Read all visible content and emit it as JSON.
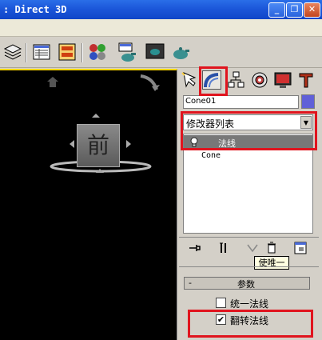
{
  "window": {
    "title": ": Direct 3D",
    "buttons": [
      "_",
      "❐",
      "✕"
    ]
  },
  "viewport": {
    "viewcube_label": "前"
  },
  "command_panel": {
    "object_name": "Cone01",
    "color_swatch": "#6060d8",
    "modifier_list_label": "修改器列表",
    "stack": {
      "selected_modifier": "法线",
      "base_object": "Cone"
    },
    "tooltip": "使唯一",
    "rollout": {
      "collapse_symbol": "-",
      "title": "参数",
      "options": [
        {
          "label": "统一法线",
          "checked": false
        },
        {
          "label": "翻转法线",
          "checked": true
        }
      ]
    }
  },
  "colors": {
    "highlight": "#e0141e",
    "titlebar": "#1a55d8",
    "viewport_border": "#ffd700"
  }
}
